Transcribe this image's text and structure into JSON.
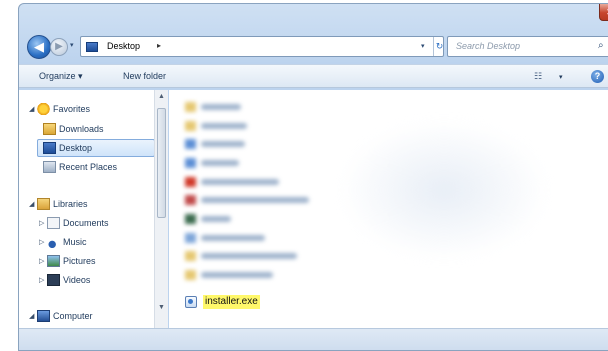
{
  "window": {
    "close_glyph": "✕"
  },
  "navigation": {
    "back_glyph": "◀",
    "forward_glyph": "▶",
    "recent_glyph": "▾"
  },
  "address": {
    "path_segment": "Desktop",
    "separator": "▸",
    "dropdown_glyph": "▾",
    "refresh_glyph": "↻"
  },
  "search": {
    "placeholder": "Search Desktop",
    "icon_glyph": "⌕"
  },
  "toolbar": {
    "organize_label": "Organize ▾",
    "new_folder_label": "New folder",
    "views_glyph": "☷",
    "views_arrow": "▾",
    "help_glyph": "?"
  },
  "nav_pane": {
    "favorites_label": "Favorites",
    "downloads_label": "Downloads",
    "desktop_label": "Desktop",
    "recent_places_label": "Recent Places",
    "libraries_label": "Libraries",
    "documents_label": "Documents",
    "music_label": "Music",
    "pictures_label": "Pictures",
    "videos_label": "Videos",
    "computer_label": "Computer",
    "expanded_arrow": "◢",
    "collapsed_arrow": "▷",
    "scroll_up": "▲",
    "scroll_down": "▼"
  },
  "files": {
    "highlighted_file": "installer.exe"
  },
  "colors": {
    "highlight": "#fff86a",
    "selection": "#cfe4fa",
    "accent": "#2a6fc4"
  }
}
